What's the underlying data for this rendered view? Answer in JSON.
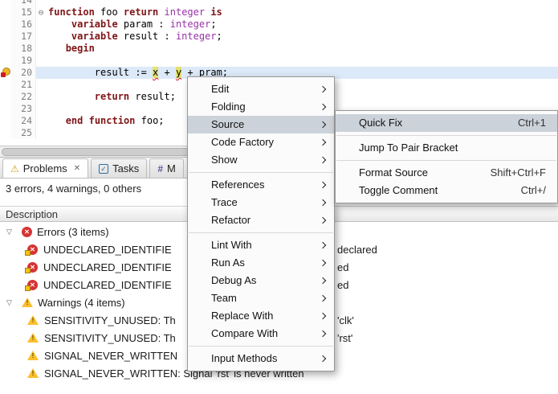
{
  "colors": {
    "keyword": "#7f1518",
    "type": "#9932a8",
    "error_red": "#e01010",
    "warning_yellow": "#fbc02d",
    "current_line": "#dce9f8",
    "occurrence_highlight": "#e3e26e",
    "menu_highlight": "#ccd2d9"
  },
  "icons": {
    "error_glyph": "✕",
    "warning_glyph": "!",
    "fold_glyph": "⊖",
    "twisty_glyph": "▽",
    "close_glyph": "✕",
    "problems_tab_glyph": "⚠",
    "tasks_tab_glyph": "✓",
    "markers_tab_glyph": "#"
  },
  "editor": {
    "fold_glyph": "⊖",
    "lines": [
      {
        "n": "14",
        "code": []
      },
      {
        "n": "15",
        "fold": true,
        "code": [
          [
            "kw",
            "function"
          ],
          [
            "pl",
            " foo "
          ],
          [
            "kw",
            "return"
          ],
          [
            "pl",
            " "
          ],
          [
            "ty",
            "integer"
          ],
          [
            "pl",
            " "
          ],
          [
            "kw",
            "is"
          ]
        ]
      },
      {
        "n": "16",
        "code": [
          [
            "pl",
            "    "
          ],
          [
            "kw",
            "variable"
          ],
          [
            "pl",
            " param : "
          ],
          [
            "ty",
            "integer"
          ],
          [
            "pl",
            ";"
          ]
        ]
      },
      {
        "n": "17",
        "code": [
          [
            "pl",
            "    "
          ],
          [
            "kw",
            "variable"
          ],
          [
            "pl",
            " result : "
          ],
          [
            "ty",
            "integer"
          ],
          [
            "pl",
            ";"
          ]
        ]
      },
      {
        "n": "18",
        "code": [
          [
            "pl",
            "   "
          ],
          [
            "kw",
            "begin"
          ]
        ]
      },
      {
        "n": "19",
        "code": []
      },
      {
        "n": "20",
        "current": true,
        "error": true,
        "code": [
          [
            "pl",
            "        result := "
          ],
          [
            "errocc",
            "x"
          ],
          [
            "pl",
            " + "
          ],
          [
            "errocc",
            "y"
          ],
          [
            "pl",
            " + "
          ],
          [
            "err",
            "pram"
          ],
          [
            "pl",
            ";"
          ]
        ]
      },
      {
        "n": "21",
        "code": []
      },
      {
        "n": "22",
        "code": [
          [
            "pl",
            "        "
          ],
          [
            "kw",
            "return"
          ],
          [
            "pl",
            " result;"
          ]
        ]
      },
      {
        "n": "23",
        "code": []
      },
      {
        "n": "24",
        "code": [
          [
            "pl",
            "   "
          ],
          [
            "kw",
            "end"
          ],
          [
            "pl",
            " "
          ],
          [
            "kw",
            "function"
          ],
          [
            "pl",
            " foo;"
          ]
        ]
      },
      {
        "n": "25",
        "code": []
      }
    ]
  },
  "problems": {
    "tabs": [
      {
        "label": "Problems"
      },
      {
        "label": "Tasks"
      },
      {
        "label": "M"
      }
    ],
    "summary": "3 errors, 4 warnings, 0 others",
    "columns": [
      "Description"
    ],
    "rows": [
      {
        "type": "group",
        "icon": "error",
        "text": "Errors (3 items)"
      },
      {
        "type": "item",
        "icon": "error",
        "left": "UNDECLARED_IDENTIFIE",
        "right": "declared"
      },
      {
        "type": "item",
        "icon": "error",
        "left": "UNDECLARED_IDENTIFIE",
        "right": "ed"
      },
      {
        "type": "item",
        "icon": "error",
        "left": "UNDECLARED_IDENTIFIE",
        "right": "ed"
      },
      {
        "type": "group",
        "icon": "warning",
        "text": "Warnings (4 items)"
      },
      {
        "type": "item",
        "icon": "warning",
        "left": "SENSITIVITY_UNUSED: Th",
        "right": "'clk'"
      },
      {
        "type": "item",
        "icon": "warning",
        "left": "SENSITIVITY_UNUSED: Th",
        "right": "'rst'"
      },
      {
        "type": "item",
        "icon": "warning",
        "left": "SIGNAL_NEVER_WRITTEN",
        "right": ""
      },
      {
        "type": "item",
        "icon": "warning",
        "left": "SIGNAL_NEVER_WRITTEN: Signal 'rst' is never written",
        "right": ""
      }
    ]
  },
  "context_menu": {
    "items": [
      {
        "label": "Edit",
        "submenu": true
      },
      {
        "label": "Folding",
        "submenu": true
      },
      {
        "label": "Source",
        "submenu": true,
        "highlighted": true
      },
      {
        "label": "Code Factory",
        "submenu": true
      },
      {
        "label": "Show",
        "submenu": true
      },
      {
        "separator": true
      },
      {
        "label": "References",
        "submenu": true
      },
      {
        "label": "Trace",
        "submenu": true
      },
      {
        "label": "Refactor",
        "submenu": true
      },
      {
        "separator": true
      },
      {
        "label": "Lint With",
        "submenu": true
      },
      {
        "label": "Run As",
        "submenu": true
      },
      {
        "label": "Debug As",
        "submenu": true
      },
      {
        "label": "Team",
        "submenu": true
      },
      {
        "label": "Replace With",
        "submenu": true
      },
      {
        "label": "Compare With",
        "submenu": true
      },
      {
        "separator": true
      },
      {
        "label": "Input Methods",
        "submenu": true
      }
    ],
    "submenu_items": [
      {
        "label": "Quick Fix",
        "shortcut": "Ctrl+1",
        "highlighted": true
      },
      {
        "separator": true
      },
      {
        "label": "Jump To Pair Bracket"
      },
      {
        "separator": true
      },
      {
        "label": "Format Source",
        "shortcut": "Shift+Ctrl+F"
      },
      {
        "label": "Toggle Comment",
        "shortcut": "Ctrl+/"
      }
    ]
  }
}
